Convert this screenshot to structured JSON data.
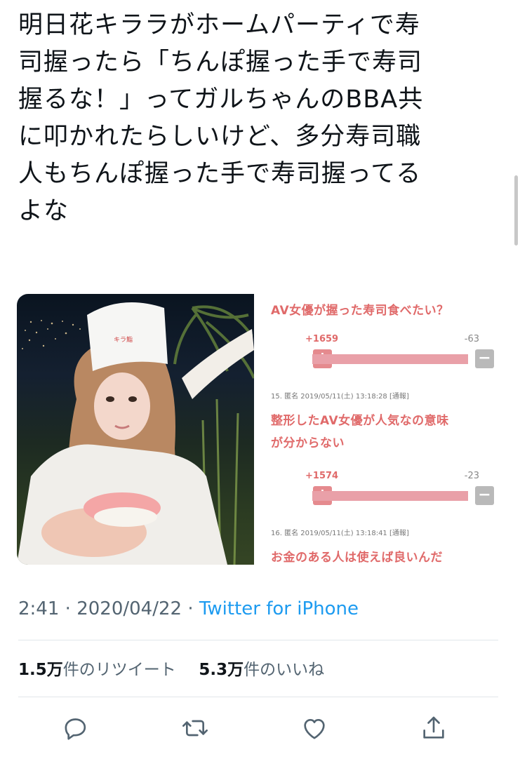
{
  "tweet": {
    "text": "明日花キララがホームパーティで寿\n司握ったら「ちんぽ握った手で寿司\n握るな！」ってガルちゃんのBBA共\nに叩かれたらしいけど、多分寿司職\n人もちんぽ握った手で寿司握ってる\nよな",
    "time": "2:41",
    "sep1": "·",
    "date": "2020/04/22",
    "sep2": "·",
    "source": "Twitter for iPhone"
  },
  "media": {
    "hat_text": "キラ鮨",
    "screenshot": {
      "comment1": {
        "title": "AV女優が握った寿司食べたい？",
        "plus": "+1659",
        "minus": "-63"
      },
      "meta15": "15. 匿名 2019/05/11(土) 13:18:28 [通報]",
      "comment2": {
        "title_line1": "整形したAV女優が人気なの意味",
        "title_line2": "が分からない",
        "plus": "+1574",
        "minus": "-23"
      },
      "meta16": "16. 匿名 2019/05/11(土) 13:18:41 [通報]",
      "comment3": {
        "title": "お金のある人は使えば良いんだ"
      },
      "plus_symbol": "+",
      "minus_symbol": "−"
    }
  },
  "stats": {
    "retweets_count": "1.5万",
    "retweets_label": "件のリツイート",
    "likes_count": "5.3万",
    "likes_label": "件のいいね"
  },
  "actions": {
    "icons": [
      "reply-icon",
      "retweet-icon",
      "like-icon",
      "share-icon"
    ]
  },
  "colors": {
    "link": "#1d9bf0",
    "secondary": "#536471",
    "ss_accent": "#e06a6a"
  }
}
